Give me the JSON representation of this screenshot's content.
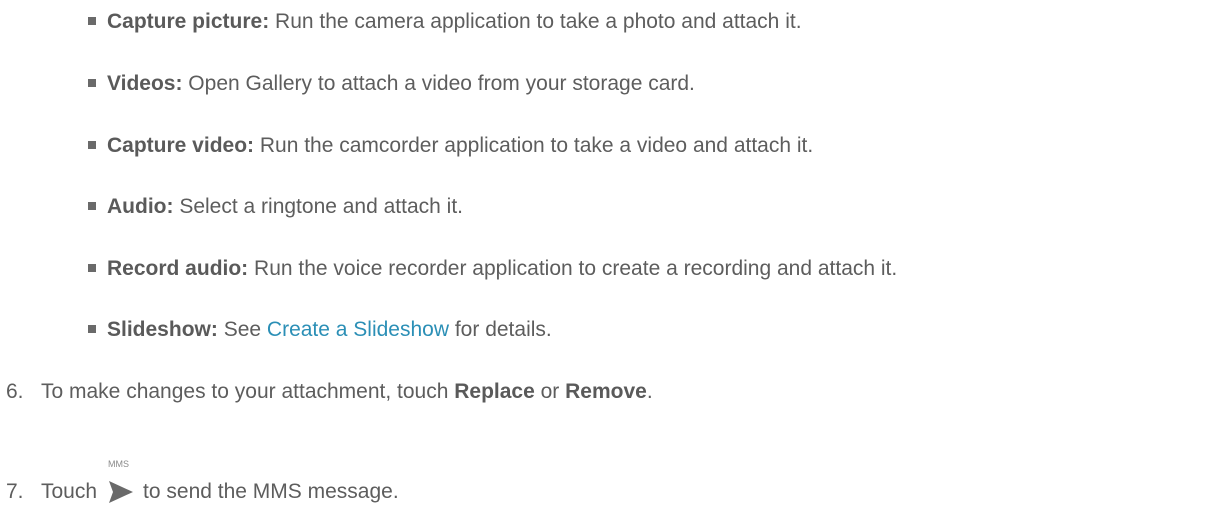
{
  "bullets": [
    {
      "term": "Capture picture:",
      "text": " Run the camera application to take a photo and attach it."
    },
    {
      "term": "Videos:",
      "text": " Open Gallery to attach a video from your storage card."
    },
    {
      "term": "Capture video:",
      "text": " Run the camcorder application to take a video and attach it."
    },
    {
      "term": "Audio:",
      "text": " Select a ringtone and attach it."
    },
    {
      "term": "Record audio:",
      "text": " Run the voice recorder application to create a recording and attach it."
    },
    {
      "term": "Slideshow:",
      "pre": " See ",
      "link": "Create a Slideshow",
      "post": " for details."
    }
  ],
  "steps": [
    {
      "number": "6.",
      "pre": "To make changes to your attachment, touch ",
      "bold1": "Replace",
      "mid": " or ",
      "bold2": "Remove",
      "post": "."
    },
    {
      "number": "7.",
      "pre": "Touch",
      "icon_label": "MMS",
      "icon": "send-icon",
      "post": "to send the MMS message."
    }
  ],
  "colors": {
    "text": "#5d5d5d",
    "link": "#2b8fb6",
    "icon": "#6a6a6a"
  }
}
